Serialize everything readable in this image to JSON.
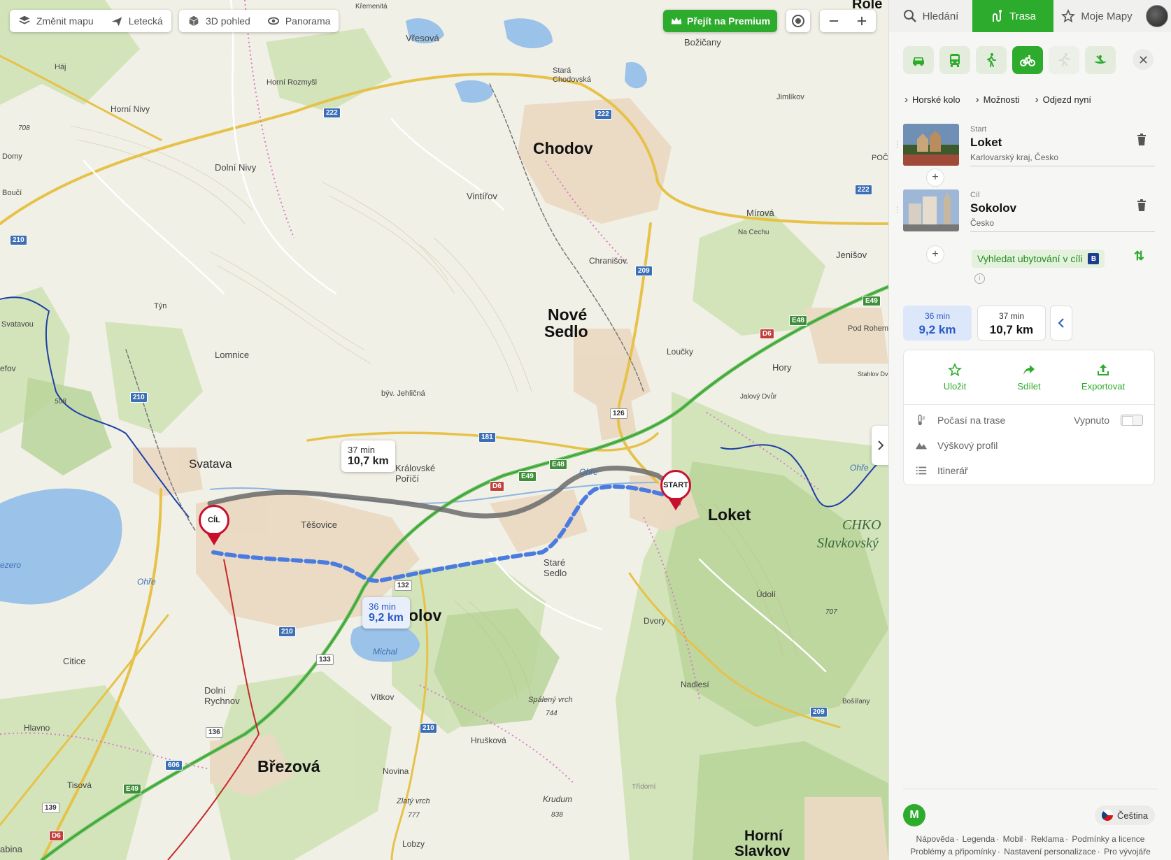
{
  "map_controls": {
    "change_map": "Změnit mapu",
    "aerial": "Letecká",
    "view3d": "3D pohled",
    "panorama": "Panorama",
    "premium": "Přejít na Premium"
  },
  "places": {
    "chodov": "Chodov",
    "nove_sedlo_1": "Nové",
    "nove_sedlo_2": "Sedlo",
    "loket": "Loket",
    "sokolov": "olov",
    "brezova": "Březová",
    "svatava": "Svatava",
    "horni_slavkov_1": "Horní",
    "horni_slavkov_2": "Slavkov",
    "vresova": "Vřesová",
    "bozicany": "Božičany",
    "stara_chodovska_1": "Stará",
    "stara_chodovska_2": "Chodovská",
    "vintirov": "Vintířov",
    "mirova": "Mírová",
    "chranisov": "Chranišov",
    "jenisov": "Jenišov",
    "lomnice": "Lomnice",
    "tesovice": "Těšovice",
    "kralovske_porici_1": "Královské",
    "kralovske_porici_2": "Poříčí",
    "stare_sedlo_1": "Staré",
    "stare_sedlo_2": "Sedlo",
    "loucky": "Loučky",
    "hory": "Hory",
    "dolni_nivy": "Dolní Nivy",
    "horni_rozmysl": "Horní Rozmyšl",
    "horni_nivy": "Horní Nivy",
    "haj": "Háj",
    "tyn": "Týn",
    "citice": "Citice",
    "dolni_rychnov_1": "Dolní",
    "dolni_rychnov_2": "Rychnov",
    "vitkov": "Vítkov",
    "hruskova": "Hrušková",
    "novina": "Novina",
    "tisova": "Tisová",
    "hlavno": "Hlavno",
    "dvory": "Dvory",
    "udoli": "Údolí",
    "nadlesi": "Nadlesí",
    "krudum": "Krudum",
    "lobzy": "Lobzy",
    "jimlikov": "Jimlíkov",
    "pod_rohem": "Pod Rohem",
    "na_cechu": "Na Cechu",
    "byv_jehlicna": "býv. Jehličná",
    "boufi": "Boučí",
    "domy": "Domy",
    "svatavou": "Svatavou",
    "efov": "efov",
    "bosirany": "Bošířany",
    "thidomi": "Třídomí",
    "jalovy_dvur": "Jalový Dvůr",
    "stahlov_dvur": "Stahlov Dvůr",
    "michal": "Michal",
    "ohre": "Ohře",
    "chko_1": "CHKO",
    "chko_2": "Slavkovský",
    "spaleny_vrch": "Spálený vrch",
    "zlaty_vrch": "Zlatý vrch",
    "kremenita": "Křemenitá",
    "role": "Role",
    "poc": "POČ",
    "abina": "abina",
    "jezero": "ezero"
  },
  "peaks": {
    "p708": "708",
    "p744": "744",
    "p777": "777",
    "p838": "838",
    "p707": "707",
    "p508": "508"
  },
  "road_numbers": {
    "r222a": "222",
    "r222b": "222",
    "r222c": "222",
    "r210a": "210",
    "r210b": "210",
    "r210c": "210",
    "r210d": "210",
    "r209": "209",
    "r209b": "209",
    "r181": "181",
    "r606": "606",
    "e48a": "E48",
    "e48b": "E48",
    "e49a": "E49",
    "e49b": "E49",
    "e49c": "E49",
    "d6a": "D6",
    "d6b": "D6",
    "d6c": "D6",
    "n126": "126",
    "n132": "132",
    "n133": "133",
    "n136": "136",
    "n139": "139"
  },
  "map_labels": {
    "cil": "CÍL",
    "start": "START",
    "bubble_alt_time": "37 min",
    "bubble_alt_dist": "10,7 km",
    "bubble_main_time": "36 min",
    "bubble_main_dist": "9,2 km"
  },
  "sidebar": {
    "tabs": {
      "search": "Hledání",
      "route": "Trasa",
      "my_maps": "Moje Mapy"
    },
    "options": {
      "bike_type": "Horské kolo",
      "options": "Možnosti",
      "departure": "Odjezd nyní"
    },
    "start": {
      "label": "Start",
      "name": "Loket",
      "sub": "Karlovarský kraj, Česko"
    },
    "end": {
      "label": "Cíl",
      "name": "Sokolov",
      "sub": "Česko"
    },
    "accommodation": "Vyhledat ubytování v cíli",
    "booking_badge": "B",
    "routes": [
      {
        "time": "36 min",
        "dist": "9,2 km"
      },
      {
        "time": "37 min",
        "dist": "10,7 km"
      }
    ],
    "actions": {
      "save": "Uložit",
      "share": "Sdílet",
      "export": "Exportovat"
    },
    "rows": {
      "weather": "Počasí na trase",
      "weather_state": "Vypnuto",
      "elevation": "Výškový profil",
      "itinerary": "Itinerář"
    },
    "language": "Čeština",
    "logo": "M",
    "links1": [
      "Nápověda",
      "Legenda",
      "Mobil",
      "Reklama",
      "Podmínky a licence"
    ],
    "links2": [
      "Problémy a připomínky",
      "Nastavení personalizace",
      "Pro vývojáře"
    ]
  },
  "colors": {
    "accent": "#2dab2d",
    "route_main": "#4a7be0",
    "route_alt": "#6b6b6b",
    "pin": "#c8102e"
  }
}
